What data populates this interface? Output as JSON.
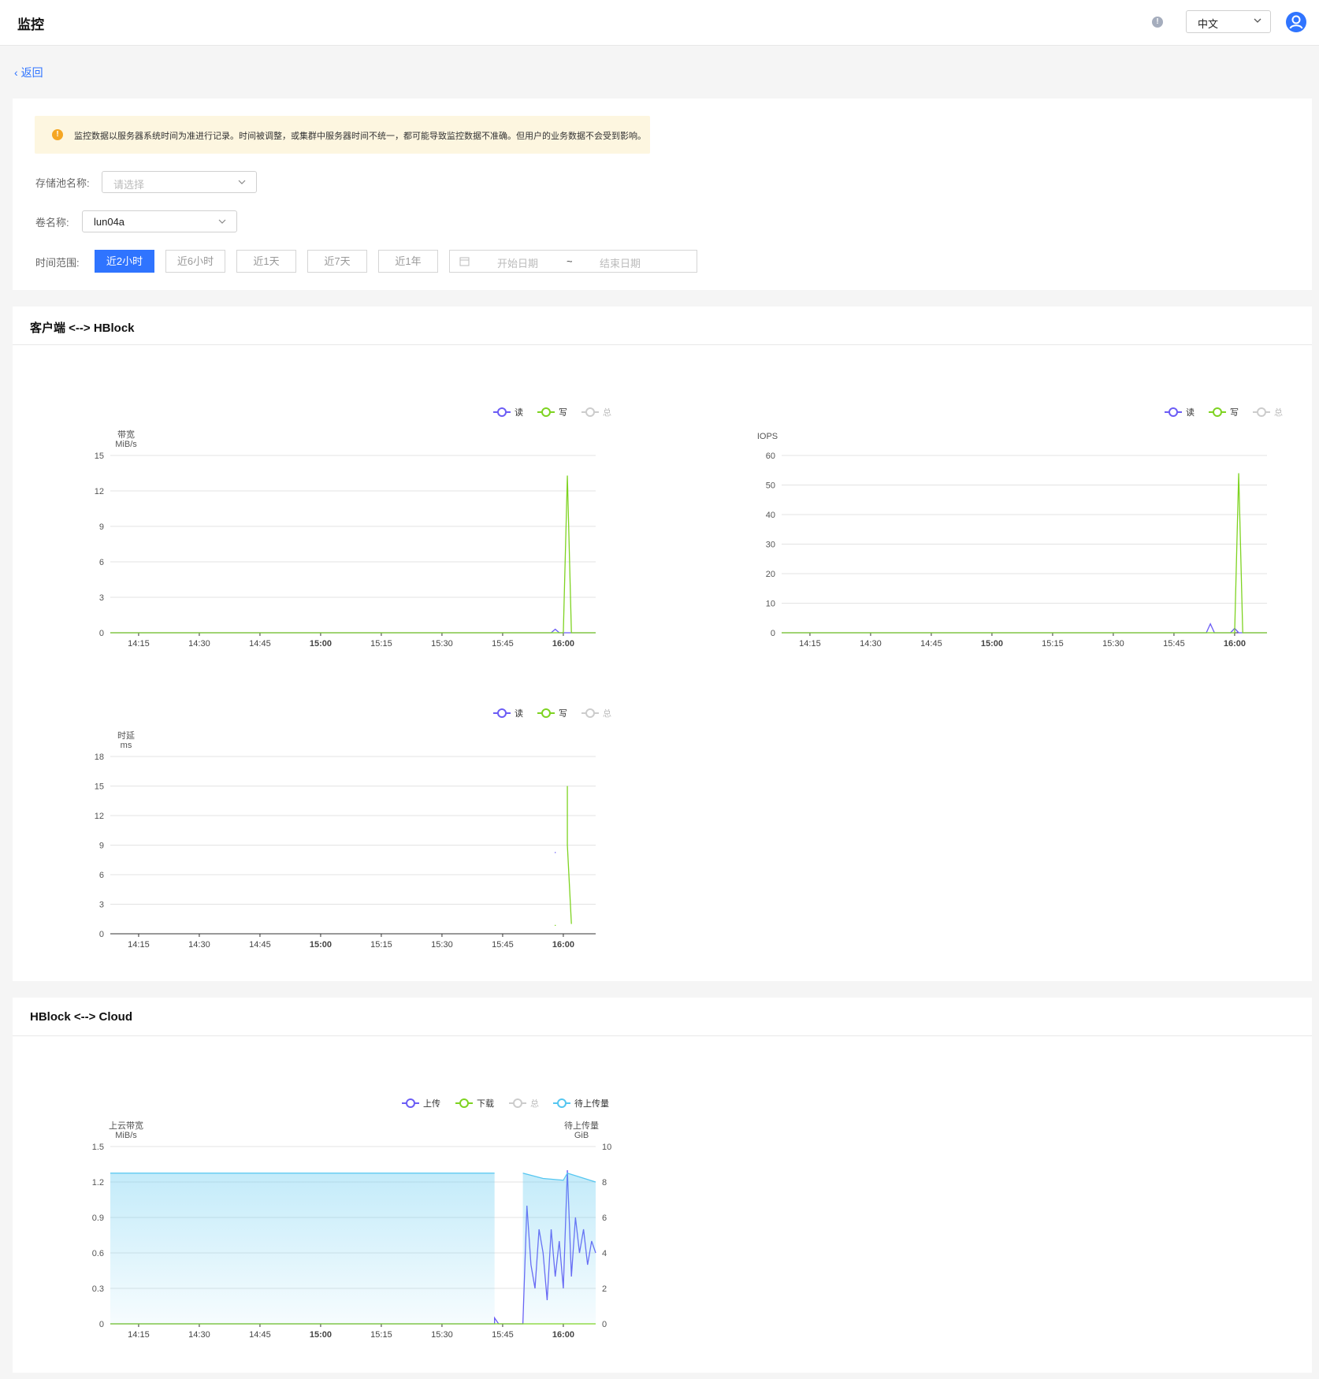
{
  "header": {
    "title": "监控",
    "language": "中文"
  },
  "back_label": "返回",
  "notice": "监控数据以服务器系统时间为准进行记录。时间被调整，或集群中服务器时间不统一，都可能导致监控数据不准确。但用户的业务数据不会受到影响。",
  "filters": {
    "pool_label": "存储池名称:",
    "pool_placeholder": "请选择",
    "volume_label": "卷名称:",
    "volume_value": "lun04a",
    "time_label": "时间范围:",
    "time_buttons": [
      "近2小时",
      "近6小时",
      "近1天",
      "近7天",
      "近1年"
    ],
    "active_time": "近2小时",
    "start_placeholder": "开始日期",
    "range_sep": "~",
    "end_placeholder": "结束日期"
  },
  "sections": {
    "client": "客户端 <--> HBlock",
    "cloud": "HBlock <--> Cloud"
  },
  "colors": {
    "read": "#6b5cf5",
    "write": "#7ed321",
    "total": "#cccccc",
    "pending": "#55c6f0",
    "accent": "#2f74ff"
  },
  "chart_data": [
    {
      "type": "line",
      "ylabel": "带宽",
      "yunit": "MiB/s",
      "ylim": [
        0,
        15
      ],
      "yticks": [
        0,
        3,
        6,
        9,
        12,
        15
      ],
      "x": [
        "14:15",
        "14:30",
        "14:45",
        "15:00",
        "15:15",
        "15:30",
        "15:45",
        "16:00"
      ],
      "x_bold": [
        "15:00",
        "16:00"
      ],
      "grid": true,
      "legend": "top-right",
      "series": [
        {
          "name": "读",
          "color": "#6b5cf5",
          "points": [
            [
              "14:08",
              0
            ],
            [
              "15:57",
              0
            ],
            [
              "15:58",
              0.3
            ],
            [
              "15:59",
              0
            ],
            [
              "16:08",
              0
            ]
          ]
        },
        {
          "name": "写",
          "color": "#7ed321",
          "points": [
            [
              "14:08",
              0
            ],
            [
              "16:00",
              0
            ],
            [
              "16:01",
              13.3
            ],
            [
              "16:02",
              0
            ],
            [
              "16:08",
              0
            ]
          ]
        },
        {
          "name": "总",
          "color": "#cccccc",
          "points": []
        }
      ]
    },
    {
      "type": "line",
      "ylabel": "IOPS",
      "yunit": "",
      "ylim": [
        0,
        60
      ],
      "yticks": [
        0,
        10,
        20,
        30,
        40,
        50,
        60
      ],
      "x": [
        "14:15",
        "14:30",
        "14:45",
        "15:00",
        "15:15",
        "15:30",
        "15:45",
        "16:00"
      ],
      "x_bold": [
        "15:00",
        "16:00"
      ],
      "grid": true,
      "legend": "top-right",
      "series": [
        {
          "name": "读",
          "color": "#6b5cf5",
          "points": [
            [
              "14:08",
              0
            ],
            [
              "15:53",
              0
            ],
            [
              "15:54",
              3
            ],
            [
              "15:55",
              0
            ],
            [
              "15:59",
              0
            ],
            [
              "16:00",
              1.5
            ],
            [
              "16:01",
              0
            ],
            [
              "16:08",
              0
            ]
          ]
        },
        {
          "name": "写",
          "color": "#7ed321",
          "points": [
            [
              "14:08",
              0
            ],
            [
              "16:00",
              0
            ],
            [
              "16:01",
              54
            ],
            [
              "16:02",
              0
            ],
            [
              "16:08",
              0
            ]
          ]
        },
        {
          "name": "总",
          "color": "#cccccc",
          "points": []
        }
      ]
    },
    {
      "type": "line",
      "ylabel": "时延",
      "yunit": "ms",
      "ylim": [
        0,
        18
      ],
      "yticks": [
        0,
        3,
        6,
        9,
        12,
        15,
        18
      ],
      "x": [
        "14:15",
        "14:30",
        "14:45",
        "15:00",
        "15:15",
        "15:30",
        "15:45",
        "16:00"
      ],
      "x_bold": [
        "15:00",
        "16:00"
      ],
      "grid": true,
      "legend": "top-right",
      "series": [
        {
          "name": "读",
          "color": "#6b5cf5",
          "points": [
            [
              "15:58",
              8.2
            ],
            [
              "15:58",
              8.3
            ]
          ]
        },
        {
          "name": "写",
          "color": "#7ed321",
          "points": [
            [
              "15:58",
              0.8
            ],
            [
              "15:58",
              0.9
            ]
          ]
        },
        {
          "name": "写",
          "color": "#7ed321",
          "points": [
            [
              "16:01",
              15
            ],
            [
              "16:01",
              9
            ],
            [
              "16:02",
              1
            ]
          ]
        },
        {
          "name": "总",
          "color": "#cccccc",
          "points": []
        }
      ]
    },
    {
      "type": "line",
      "ylabel": "上云带宽",
      "yunit": "MiB/s",
      "ylabel_right": "待上传量",
      "yunit_right": "GiB",
      "ylim": [
        0,
        1.5
      ],
      "yticks": [
        0,
        0.3,
        0.6,
        0.9,
        1.2,
        1.5
      ],
      "ylim_right": [
        0,
        10
      ],
      "yticks_right": [
        0,
        2,
        4,
        6,
        8,
        10
      ],
      "x": [
        "14:15",
        "14:30",
        "14:45",
        "15:00",
        "15:15",
        "15:30",
        "15:45",
        "16:00"
      ],
      "x_bold": [
        "15:00",
        "16:00"
      ],
      "grid": true,
      "legend": "top-right",
      "series": [
        {
          "name": "上传",
          "color": "#6b5cf5",
          "points": [
            [
              "14:08",
              0
            ],
            [
              "15:43",
              0
            ],
            [
              "15:43",
              0.05
            ],
            [
              "15:44",
              0
            ],
            [
              "15:50",
              0
            ],
            [
              "15:51",
              1.0
            ],
            [
              "15:52",
              0.5
            ],
            [
              "15:53",
              0.3
            ],
            [
              "15:54",
              0.8
            ],
            [
              "15:55",
              0.6
            ],
            [
              "15:56",
              0.2
            ],
            [
              "15:57",
              0.8
            ],
            [
              "15:58",
              0.4
            ],
            [
              "15:59",
              0.7
            ],
            [
              "16:00",
              0.3
            ],
            [
              "16:01",
              1.3
            ],
            [
              "16:02",
              0.4
            ],
            [
              "16:03",
              0.9
            ],
            [
              "16:04",
              0.6
            ],
            [
              "16:05",
              0.8
            ],
            [
              "16:06",
              0.5
            ],
            [
              "16:07",
              0.7
            ],
            [
              "16:08",
              0.6
            ]
          ]
        },
        {
          "name": "下载",
          "color": "#7ed321",
          "points": [
            [
              "14:08",
              0
            ],
            [
              "16:08",
              0
            ]
          ]
        },
        {
          "name": "总",
          "color": "#cccccc",
          "points": []
        },
        {
          "name": "待上传量",
          "color": "#55c6f0",
          "area": true,
          "axis": "right",
          "segments": [
            [
              [
                "14:08",
                8.5
              ],
              [
                "15:43",
                8.5
              ]
            ],
            [
              [
                "15:50",
                8.5
              ],
              [
                "15:55",
                8.2
              ],
              [
                "16:00",
                8.1
              ],
              [
                "16:01",
                8.5
              ],
              [
                "16:08",
                8.0
              ]
            ]
          ]
        }
      ]
    }
  ]
}
